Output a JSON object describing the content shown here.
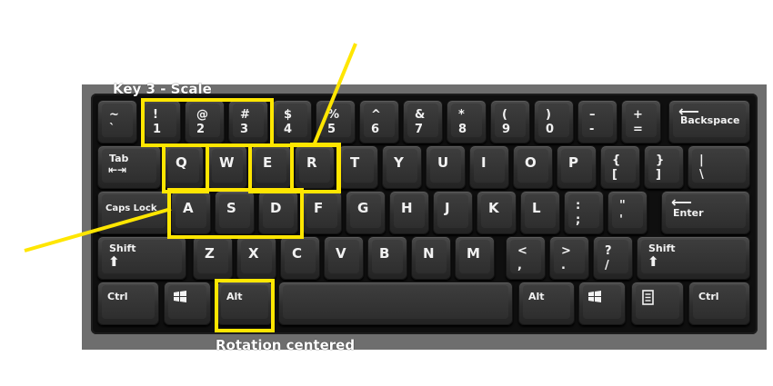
{
  "caption_top": "Key 3 - Scale",
  "caption_bottom": "Rotation centered",
  "highlight_color": "#ffe600",
  "keys": {
    "tilde": {
      "top": "~",
      "bot": "`"
    },
    "n1": {
      "top": "!",
      "bot": "1"
    },
    "n2": {
      "top": "@",
      "bot": "2"
    },
    "n3": {
      "top": "#",
      "bot": "3"
    },
    "n4": {
      "top": "$",
      "bot": "4"
    },
    "n5": {
      "top": "%",
      "bot": "5"
    },
    "n6": {
      "top": "^",
      "bot": "6"
    },
    "n7": {
      "top": "&",
      "bot": "7"
    },
    "n8": {
      "top": "*",
      "bot": "8"
    },
    "n9": {
      "top": "(",
      "bot": "9"
    },
    "n0": {
      "top": ")",
      "bot": "0"
    },
    "minus": {
      "top": "–",
      "bot": "-"
    },
    "equals": {
      "top": "+",
      "bot": "="
    },
    "backspace": {
      "glyph": "⟵",
      "label": "Backspace"
    },
    "tab": {
      "label": "Tab",
      "glyph": "⇤⇥"
    },
    "q": "Q",
    "w": "W",
    "e": "E",
    "r": "R",
    "t": "T",
    "y": "Y",
    "u": "U",
    "i": "I",
    "o": "O",
    "p": "P",
    "lbrace": {
      "top": "{",
      "bot": "["
    },
    "rbrace": {
      "top": "}",
      "bot": "]"
    },
    "pipe": {
      "top": "|",
      "bot": "\\"
    },
    "capslock": "Caps Lock",
    "a": "A",
    "s": "S",
    "d": "D",
    "f": "F",
    "g": "G",
    "h": "H",
    "j": "J",
    "k": "K",
    "l": "L",
    "semicolon": {
      "top": ":",
      "bot": ";"
    },
    "quote": {
      "top": "\"",
      "bot": "'"
    },
    "enter": {
      "glyph": "⟵",
      "label": "Enter"
    },
    "lshift": {
      "label": "Shift",
      "glyph": "⬆"
    },
    "z": "Z",
    "x": "X",
    "c": "C",
    "v": "V",
    "b": "B",
    "n": "N",
    "m": "M",
    "comma": {
      "top": "<",
      "bot": ","
    },
    "period": {
      "top": ">",
      "bot": "."
    },
    "slash": {
      "top": "?",
      "bot": "/"
    },
    "rshift": {
      "label": "Shift",
      "glyph": "⬆"
    },
    "lctrl": "Ctrl",
    "lwin": "win-logo-icon",
    "lalt": "Alt",
    "ralt": "Alt",
    "rwin": "win-logo-icon",
    "menu": "menu-key-icon",
    "rctrl": "Ctrl"
  }
}
